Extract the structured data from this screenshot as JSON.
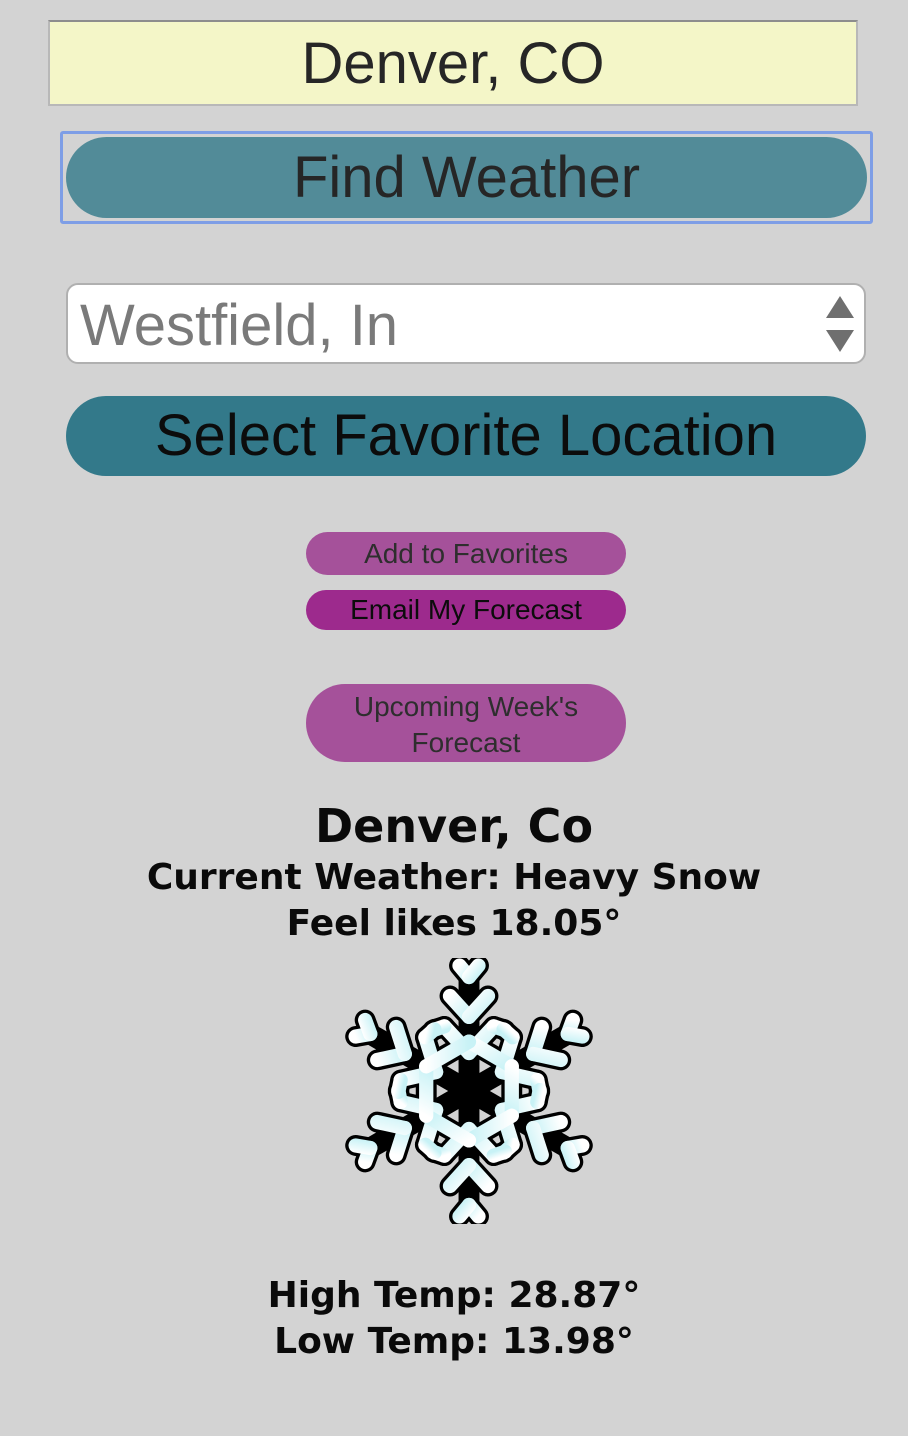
{
  "search": {
    "input_value": "Denver, CO",
    "find_button": "Find Weather"
  },
  "favorites": {
    "selected": "Westfield, In",
    "select_button": "Select Favorite Location",
    "add_button": "Add to Favorites",
    "email_button": "Email My Forecast",
    "week_button_line1": "Upcoming Week's",
    "week_button_line2": "Forecast"
  },
  "weather": {
    "city": "Denver, Co",
    "current_weather": "Current Weather: Heavy Snow",
    "feels_like": "Feel likes 18.05°",
    "icon": "snowflake-icon",
    "high_temp": "High Temp: 28.87°",
    "low_temp": "Low Temp: 13.98°"
  },
  "colors": {
    "background": "#d3d3d3",
    "input_background": "#f4f6c8",
    "find_button": "#528b98",
    "select_button": "#33798a",
    "pill_button": "#a5519a",
    "email_button": "#9d2a8d",
    "focus_ring": "#7e9ee6"
  }
}
